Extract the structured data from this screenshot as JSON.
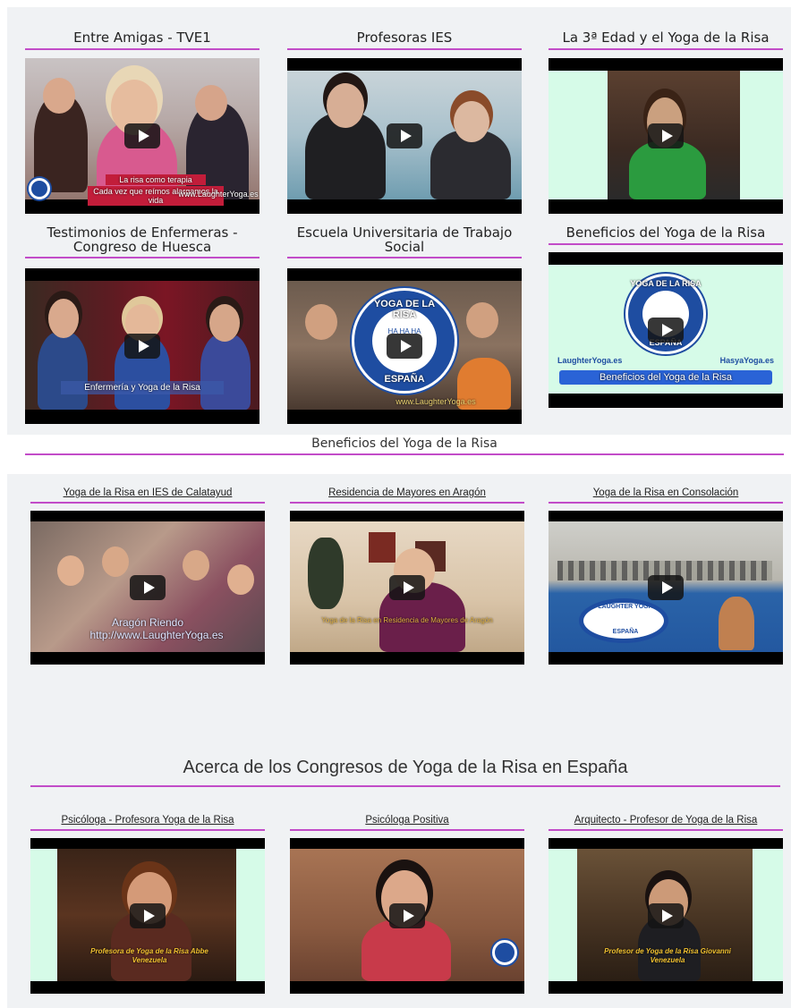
{
  "top_section": {
    "videos": [
      {
        "title": "Entre Amigas - TVE1",
        "caption_line1": "La risa como terapia",
        "caption_line2": "Cada vez que reímos alargamos la vida",
        "brand": "www.LaughterYoga.es"
      },
      {
        "title": "Profesoras IES"
      },
      {
        "title": "La 3ª Edad y el Yoga de la Risa"
      },
      {
        "title": "Testimonios de Enfermeras - Congreso de Huesca",
        "caption": "Enfermería y Yoga de la Risa"
      },
      {
        "title": "Escuela Universitaria de Trabajo Social",
        "logo_text_top": "YOGA DE LA RISA",
        "logo_text_bottom": "ESPAÑA",
        "logo_laughs": "HA HA HA",
        "brand": "www.LaughterYoga.es"
      },
      {
        "title": "Beneficios del Yoga de la Risa",
        "logo_text_top": "YOGA DE LA RISA",
        "logo_text_bottom": "ESPAÑA",
        "left_brand": "LaughterYoga.es",
        "right_brand": "HasyaYoga.es",
        "banner": "Beneficios del Yoga de la Risa"
      }
    ],
    "footer_heading": "Beneficios del Yoga de la Risa"
  },
  "bottom_section": {
    "videos_row1": [
      {
        "title": "Yoga de la Risa en IES de Calatayud",
        "caption_line1": "Aragón Riendo",
        "caption_line2": "http://www.LaughterYoga.es"
      },
      {
        "title": "Residencia de Mayores en Aragón",
        "caption": "Yoga de la Risa en Residencia de Mayores de Aragón"
      },
      {
        "title": "Yoga de la Risa en Consolación",
        "logo_text": "LAUGHTER YOGA",
        "logo_sub": "ESPAÑA"
      }
    ],
    "heading": "Acerca de los Congresos de Yoga de la Risa en España",
    "videos_row2": [
      {
        "title": "Psicóloga - Profesora Yoga de la Risa",
        "caption_line1": "Profesora de Yoga de la Risa  Abbe",
        "caption_line2": "Venezuela"
      },
      {
        "title": "Psicóloga Positiva"
      },
      {
        "title": "Arquitecto - Profesor de Yoga de la Risa",
        "caption_line1": "Profesor de Yoga de la Risa  Giovanni",
        "caption_line2": "Venezuela"
      }
    ]
  },
  "colors": {
    "accent_underline": "#c24cc8",
    "panel_background": "#f0f2f4",
    "mint_side_bars": "#d6fbe8",
    "logo_blue": "#1e4da1"
  }
}
